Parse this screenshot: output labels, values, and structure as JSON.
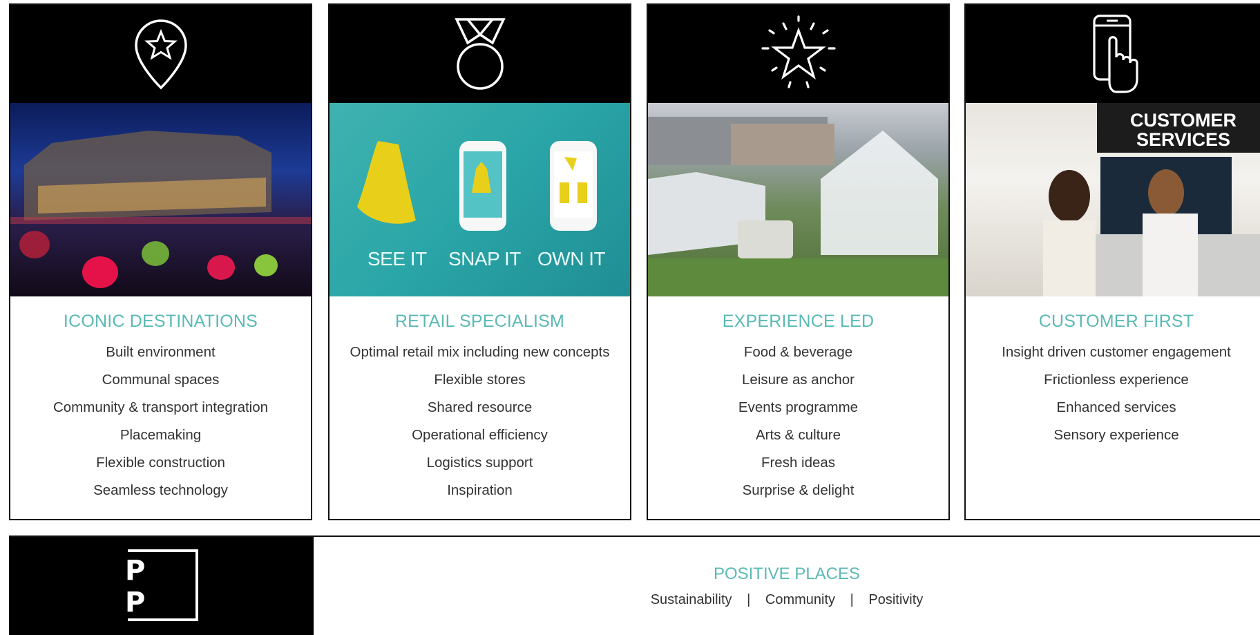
{
  "cards": [
    {
      "title": "ICONIC DESTINATIONS",
      "icon": "location-star-pin-icon",
      "items": [
        "Built environment",
        "Communal spaces",
        "Community & transport integration",
        "Placemaking",
        "Flexible construction",
        "Seamless technology"
      ]
    },
    {
      "title": "RETAIL SPECIALISM",
      "icon": "medal-icon",
      "photo_labels": [
        "SEE IT",
        "SNAP IT",
        "OWN IT"
      ],
      "items": [
        "Optimal retail mix including new concepts",
        "Flexible stores",
        "Shared resource",
        "Operational efficiency",
        "Logistics support",
        "Inspiration"
      ]
    },
    {
      "title": "EXPERIENCE LED",
      "icon": "shining-star-icon",
      "items": [
        "Food & beverage",
        "Leisure as anchor",
        "Events programme",
        "Arts & culture",
        "Fresh ideas",
        "Surprise & delight"
      ]
    },
    {
      "title": "CUSTOMER FIRST",
      "icon": "phone-tap-icon",
      "photo_sign": [
        "CUSTOMER",
        "SERVICES"
      ],
      "items": [
        "Insight driven customer engagement",
        "Frictionless experience",
        "Enhanced services",
        "Sensory experience"
      ]
    }
  ],
  "positive_places": {
    "logo_letters": [
      "P",
      "P"
    ],
    "title": "POSITIVE PLACES",
    "pillars": [
      "Sustainability",
      "Community",
      "Positivity"
    ],
    "separator": "|"
  },
  "colors": {
    "accent": "#5ab9b5",
    "black": "#000000",
    "text": "#333333"
  }
}
